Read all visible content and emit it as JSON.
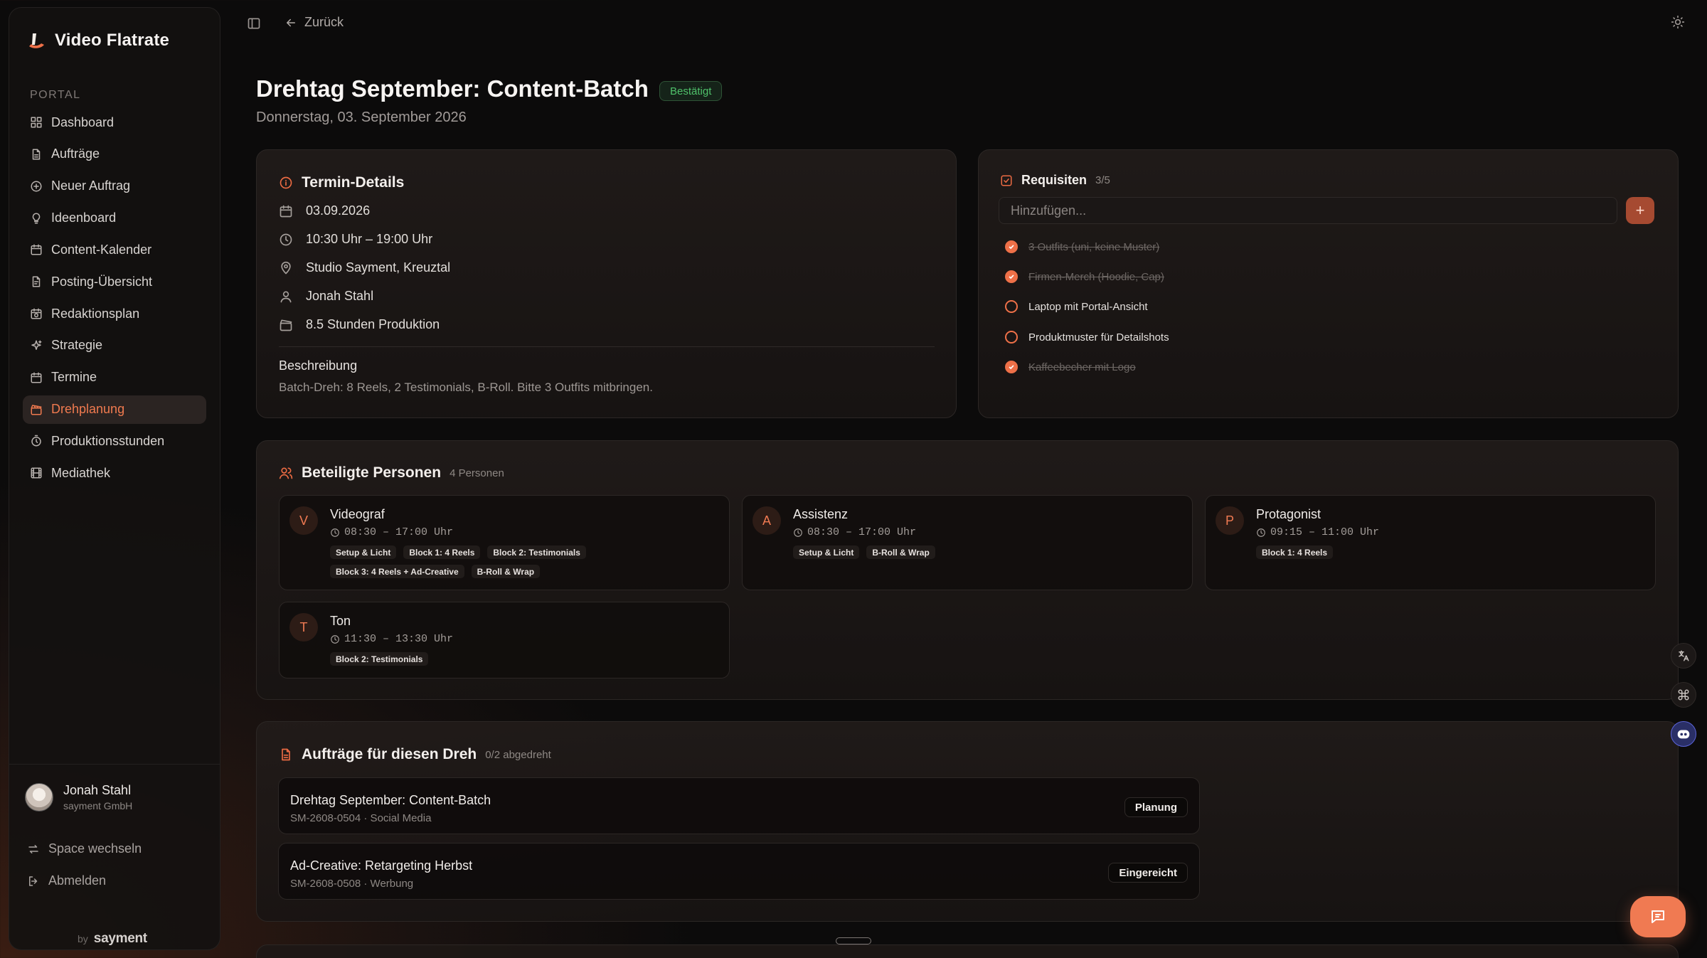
{
  "app": {
    "name": "Video Flatrate"
  },
  "sidebar": {
    "section_label": "PORTAL",
    "items": [
      {
        "label": "Dashboard",
        "icon": "dashboard-icon"
      },
      {
        "label": "Aufträge",
        "icon": "document-icon"
      },
      {
        "label": "Neuer Auftrag",
        "icon": "plus-circle-icon"
      },
      {
        "label": "Ideenboard",
        "icon": "lightbulb-icon"
      },
      {
        "label": "Content-Kalender",
        "icon": "calendar-icon"
      },
      {
        "label": "Posting-Übersicht",
        "icon": "file-text-icon"
      },
      {
        "label": "Redaktionsplan",
        "icon": "calendar-clock-icon"
      },
      {
        "label": "Strategie",
        "icon": "sparkles-icon"
      },
      {
        "label": "Termine",
        "icon": "calendar-icon"
      },
      {
        "label": "Drehplanung",
        "icon": "clapperboard-icon",
        "active": true
      },
      {
        "label": "Produktionsstunden",
        "icon": "timer-icon"
      },
      {
        "label": "Mediathek",
        "icon": "film-icon"
      }
    ],
    "user": {
      "name": "Jonah Stahl",
      "org": "sayment GmbH"
    },
    "switch_space": "Space wechseln",
    "logout": "Abmelden",
    "byline_prefix": "by",
    "byline_brand": "sayment"
  },
  "topbar": {
    "back_label": "Zurück"
  },
  "page": {
    "title": "Drehtag September: Content-Batch",
    "status": "Bestätigt",
    "subtitle": "Donnerstag, 03. September 2026"
  },
  "details": {
    "title": "Termin-Details",
    "date": "03.09.2026",
    "time": "10:30 Uhr – 19:00 Uhr",
    "location": "Studio Sayment, Kreuztal",
    "person": "Jonah Stahl",
    "production": "8.5 Stunden Produktion",
    "description_label": "Beschreibung",
    "description": "Batch-Dreh: 8 Reels, 2 Testimonials, B-Roll. Bitte 3 Outfits mitbringen."
  },
  "requisites": {
    "title": "Requisiten",
    "count": "3/5",
    "placeholder": "Hinzufügen...",
    "add_label": "+",
    "items": [
      {
        "label": "3 Outfits (uni, keine Muster)",
        "done": true
      },
      {
        "label": "Firmen-Merch (Hoodie, Cap)",
        "done": true
      },
      {
        "label": "Laptop mit Portal-Ansicht",
        "done": false
      },
      {
        "label": "Produktmuster für Detailshots",
        "done": false
      },
      {
        "label": "Kaffeebecher mit Logo",
        "done": true
      }
    ]
  },
  "persons": {
    "title": "Beteiligte Personen",
    "count": "4 Personen",
    "list": [
      {
        "initial": "V",
        "role": "Videograf",
        "time": "08:30 – 17:00 Uhr",
        "tags": [
          "Setup & Licht",
          "Block 1: 4 Reels",
          "Block 2: Testimonials",
          "Block 3: 4 Reels + Ad-Creative",
          "B-Roll & Wrap"
        ]
      },
      {
        "initial": "A",
        "role": "Assistenz",
        "time": "08:30 – 17:00 Uhr",
        "tags": [
          "Setup & Licht",
          "B-Roll & Wrap"
        ]
      },
      {
        "initial": "P",
        "role": "Protagonist",
        "time": "09:15 – 11:00 Uhr",
        "tags": [
          "Block 1: 4 Reels"
        ]
      },
      {
        "initial": "T",
        "role": "Ton",
        "time": "11:30 – 13:30 Uhr",
        "tags": [
          "Block 2: Testimonials"
        ]
      }
    ]
  },
  "orders": {
    "title": "Aufträge für diesen Dreh",
    "count": "0/2 abgedreht",
    "list": [
      {
        "title": "Drehtag September: Content-Batch",
        "meta": "SM-2608-0504 · Social Media",
        "status": "Planung"
      },
      {
        "title": "Ad-Creative: Retargeting Herbst",
        "meta": "SM-2608-0508 · Werbung",
        "status": "Eingereicht"
      }
    ]
  },
  "colors": {
    "accent": "#ec6b43",
    "confirmed": "#4fc06a"
  }
}
